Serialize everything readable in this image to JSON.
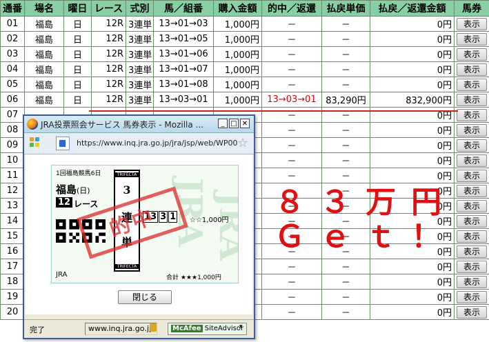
{
  "table": {
    "headers": [
      "通番",
      "場名",
      "曜日",
      "レース",
      "式別",
      "馬／組番",
      "購入金額",
      "的中／返還",
      "払戻単価",
      "払戻／返還金額",
      "馬券"
    ],
    "rows": [
      {
        "no": "01",
        "place": "福島",
        "day": "日",
        "race": "12R",
        "type": "3連単",
        "combo": "13→01→03",
        "amount": "1,000円",
        "hit": "－",
        "unit": "－",
        "payout": "0円",
        "btn": "表示"
      },
      {
        "no": "02",
        "place": "福島",
        "day": "日",
        "race": "12R",
        "type": "3連単",
        "combo": "13→01→05",
        "amount": "1,000円",
        "hit": "－",
        "unit": "－",
        "payout": "0円",
        "btn": "表示"
      },
      {
        "no": "03",
        "place": "福島",
        "day": "日",
        "race": "12R",
        "type": "3連単",
        "combo": "13→01→06",
        "amount": "1,000円",
        "hit": "－",
        "unit": "－",
        "payout": "0円",
        "btn": "表示"
      },
      {
        "no": "04",
        "place": "福島",
        "day": "日",
        "race": "12R",
        "type": "3連単",
        "combo": "13→01→07",
        "amount": "1,000円",
        "hit": "－",
        "unit": "－",
        "payout": "0円",
        "btn": "表示"
      },
      {
        "no": "05",
        "place": "福島",
        "day": "日",
        "race": "12R",
        "type": "3連単",
        "combo": "13→01→08",
        "amount": "1,000円",
        "hit": "－",
        "unit": "－",
        "payout": "0円",
        "btn": "表示"
      },
      {
        "no": "06",
        "place": "福島",
        "day": "日",
        "race": "12R",
        "type": "3連単",
        "combo": "13→03→01",
        "amount": "1,000円",
        "hit": "13→03→01",
        "unit": "83,290円",
        "payout": "832,900円",
        "btn": "表示"
      },
      {
        "no": "07",
        "place": "",
        "day": "",
        "race": "",
        "type": "",
        "combo": "",
        "amount": "",
        "hit": "－",
        "unit": "－",
        "payout": "0円",
        "btn": "表示"
      },
      {
        "no": "08",
        "place": "",
        "day": "",
        "race": "",
        "type": "",
        "combo": "",
        "amount": "",
        "hit": "－",
        "unit": "－",
        "payout": "0円",
        "btn": "表示"
      },
      {
        "no": "09",
        "place": "",
        "day": "",
        "race": "",
        "type": "",
        "combo": "",
        "amount": "",
        "hit": "－",
        "unit": "－",
        "payout": "0円",
        "btn": "表示"
      },
      {
        "no": "10",
        "place": "",
        "day": "",
        "race": "",
        "type": "",
        "combo": "",
        "amount": "",
        "hit": "－",
        "unit": "－",
        "payout": "0円",
        "btn": "表示"
      },
      {
        "no": "11",
        "place": "",
        "day": "",
        "race": "",
        "type": "",
        "combo": "",
        "amount": "",
        "hit": "－",
        "unit": "－",
        "payout": "0円",
        "btn": "表示"
      },
      {
        "no": "12",
        "place": "",
        "day": "",
        "race": "",
        "type": "",
        "combo": "",
        "amount": "",
        "hit": "－",
        "unit": "－",
        "payout": "0円",
        "btn": "表示"
      },
      {
        "no": "13",
        "place": "",
        "day": "",
        "race": "",
        "type": "",
        "combo": "",
        "amount": "",
        "hit": "－",
        "unit": "－",
        "payout": "0円",
        "btn": "表示"
      },
      {
        "no": "14",
        "place": "",
        "day": "",
        "race": "",
        "type": "",
        "combo": "",
        "amount": "",
        "hit": "－",
        "unit": "－",
        "payout": "0円",
        "btn": "表示"
      },
      {
        "no": "15",
        "place": "",
        "day": "",
        "race": "",
        "type": "",
        "combo": "",
        "amount": "",
        "hit": "－",
        "unit": "－",
        "payout": "0円",
        "btn": "表示"
      },
      {
        "no": "16",
        "place": "",
        "day": "",
        "race": "",
        "type": "",
        "combo": "",
        "amount": "",
        "hit": "－",
        "unit": "－",
        "payout": "0円",
        "btn": "表示"
      },
      {
        "no": "17",
        "place": "",
        "day": "",
        "race": "",
        "type": "",
        "combo": "",
        "amount": "",
        "hit": "－",
        "unit": "－",
        "payout": "0円",
        "btn": "表示"
      },
      {
        "no": "18",
        "place": "",
        "day": "",
        "race": "",
        "type": "",
        "combo": "",
        "amount": "",
        "hit": "－",
        "unit": "－",
        "payout": "0円",
        "btn": "表示"
      },
      {
        "no": "19",
        "place": "",
        "day": "",
        "race": "",
        "type": "",
        "combo": "",
        "amount": "",
        "hit": "－",
        "unit": "－",
        "payout": "0円",
        "btn": "表示"
      },
      {
        "no": "20",
        "place": "",
        "day": "",
        "race": "",
        "type": "",
        "combo": "",
        "amount": "",
        "hit": "－",
        "unit": "－",
        "payout": "0円",
        "btn": "表示"
      }
    ]
  },
  "popup": {
    "title": "JRA投票照会サービス 馬券表示 - Mozilla ...",
    "url": "https://www.inq.jra.go.jp/jra/jsp/web/WP00",
    "close_label": "閉じる",
    "status_text": "完了",
    "status_domain": "www.inq.jra.go.jp",
    "mcafee_brand": "McAfee",
    "mcafee_label": "SiteAdvisor",
    "ticket": {
      "race_info": "1回福島競馬6日",
      "venue": "福島",
      "day": "(日)",
      "race_num": "12",
      "race_label": "レース",
      "trifecta_top": "TRIFECTA",
      "trifecta_bottom": "TRIFECTA",
      "bet_chars": [
        "3",
        "連",
        "単"
      ],
      "nums": [
        "13",
        "3",
        "1"
      ],
      "amount": "☆☆1,000円",
      "brand": "JRA",
      "total": "合計 ★★★1,000円",
      "stamp": "的中"
    }
  },
  "overlay": {
    "line1": "８３万円",
    "line2": "Ｇｅｔ！"
  },
  "colors": {
    "header_bg": "#88d0a4",
    "hit_text": "#e00000",
    "overlay_text": "#e01010"
  }
}
